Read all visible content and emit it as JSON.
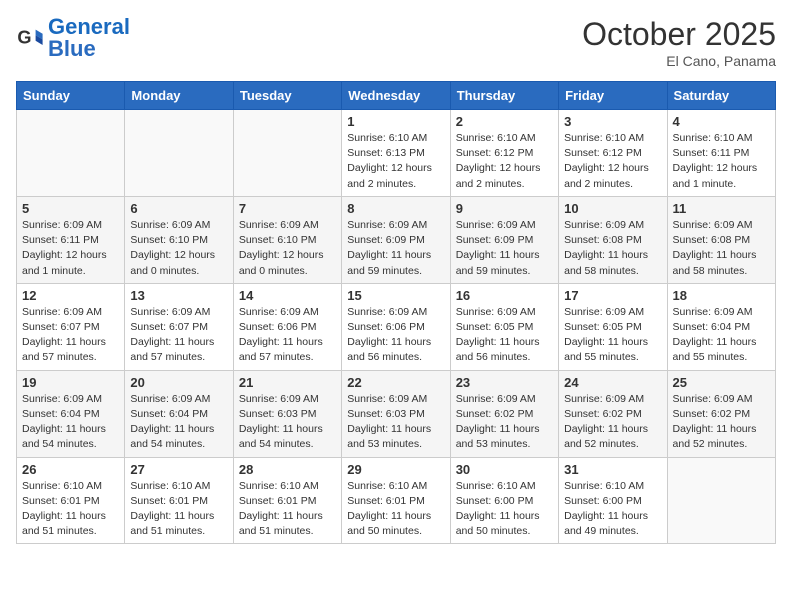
{
  "logo": {
    "text1": "General",
    "text2": "Blue"
  },
  "title": "October 2025",
  "location": "El Cano, Panama",
  "weekdays": [
    "Sunday",
    "Monday",
    "Tuesday",
    "Wednesday",
    "Thursday",
    "Friday",
    "Saturday"
  ],
  "weeks": [
    [
      {
        "day": "",
        "info": ""
      },
      {
        "day": "",
        "info": ""
      },
      {
        "day": "",
        "info": ""
      },
      {
        "day": "1",
        "info": "Sunrise: 6:10 AM\nSunset: 6:13 PM\nDaylight: 12 hours and 2 minutes."
      },
      {
        "day": "2",
        "info": "Sunrise: 6:10 AM\nSunset: 6:12 PM\nDaylight: 12 hours and 2 minutes."
      },
      {
        "day": "3",
        "info": "Sunrise: 6:10 AM\nSunset: 6:12 PM\nDaylight: 12 hours and 2 minutes."
      },
      {
        "day": "4",
        "info": "Sunrise: 6:10 AM\nSunset: 6:11 PM\nDaylight: 12 hours and 1 minute."
      }
    ],
    [
      {
        "day": "5",
        "info": "Sunrise: 6:09 AM\nSunset: 6:11 PM\nDaylight: 12 hours and 1 minute."
      },
      {
        "day": "6",
        "info": "Sunrise: 6:09 AM\nSunset: 6:10 PM\nDaylight: 12 hours and 0 minutes."
      },
      {
        "day": "7",
        "info": "Sunrise: 6:09 AM\nSunset: 6:10 PM\nDaylight: 12 hours and 0 minutes."
      },
      {
        "day": "8",
        "info": "Sunrise: 6:09 AM\nSunset: 6:09 PM\nDaylight: 11 hours and 59 minutes."
      },
      {
        "day": "9",
        "info": "Sunrise: 6:09 AM\nSunset: 6:09 PM\nDaylight: 11 hours and 59 minutes."
      },
      {
        "day": "10",
        "info": "Sunrise: 6:09 AM\nSunset: 6:08 PM\nDaylight: 11 hours and 58 minutes."
      },
      {
        "day": "11",
        "info": "Sunrise: 6:09 AM\nSunset: 6:08 PM\nDaylight: 11 hours and 58 minutes."
      }
    ],
    [
      {
        "day": "12",
        "info": "Sunrise: 6:09 AM\nSunset: 6:07 PM\nDaylight: 11 hours and 57 minutes."
      },
      {
        "day": "13",
        "info": "Sunrise: 6:09 AM\nSunset: 6:07 PM\nDaylight: 11 hours and 57 minutes."
      },
      {
        "day": "14",
        "info": "Sunrise: 6:09 AM\nSunset: 6:06 PM\nDaylight: 11 hours and 57 minutes."
      },
      {
        "day": "15",
        "info": "Sunrise: 6:09 AM\nSunset: 6:06 PM\nDaylight: 11 hours and 56 minutes."
      },
      {
        "day": "16",
        "info": "Sunrise: 6:09 AM\nSunset: 6:05 PM\nDaylight: 11 hours and 56 minutes."
      },
      {
        "day": "17",
        "info": "Sunrise: 6:09 AM\nSunset: 6:05 PM\nDaylight: 11 hours and 55 minutes."
      },
      {
        "day": "18",
        "info": "Sunrise: 6:09 AM\nSunset: 6:04 PM\nDaylight: 11 hours and 55 minutes."
      }
    ],
    [
      {
        "day": "19",
        "info": "Sunrise: 6:09 AM\nSunset: 6:04 PM\nDaylight: 11 hours and 54 minutes."
      },
      {
        "day": "20",
        "info": "Sunrise: 6:09 AM\nSunset: 6:04 PM\nDaylight: 11 hours and 54 minutes."
      },
      {
        "day": "21",
        "info": "Sunrise: 6:09 AM\nSunset: 6:03 PM\nDaylight: 11 hours and 54 minutes."
      },
      {
        "day": "22",
        "info": "Sunrise: 6:09 AM\nSunset: 6:03 PM\nDaylight: 11 hours and 53 minutes."
      },
      {
        "day": "23",
        "info": "Sunrise: 6:09 AM\nSunset: 6:02 PM\nDaylight: 11 hours and 53 minutes."
      },
      {
        "day": "24",
        "info": "Sunrise: 6:09 AM\nSunset: 6:02 PM\nDaylight: 11 hours and 52 minutes."
      },
      {
        "day": "25",
        "info": "Sunrise: 6:09 AM\nSunset: 6:02 PM\nDaylight: 11 hours and 52 minutes."
      }
    ],
    [
      {
        "day": "26",
        "info": "Sunrise: 6:10 AM\nSunset: 6:01 PM\nDaylight: 11 hours and 51 minutes."
      },
      {
        "day": "27",
        "info": "Sunrise: 6:10 AM\nSunset: 6:01 PM\nDaylight: 11 hours and 51 minutes."
      },
      {
        "day": "28",
        "info": "Sunrise: 6:10 AM\nSunset: 6:01 PM\nDaylight: 11 hours and 51 minutes."
      },
      {
        "day": "29",
        "info": "Sunrise: 6:10 AM\nSunset: 6:01 PM\nDaylight: 11 hours and 50 minutes."
      },
      {
        "day": "30",
        "info": "Sunrise: 6:10 AM\nSunset: 6:00 PM\nDaylight: 11 hours and 50 minutes."
      },
      {
        "day": "31",
        "info": "Sunrise: 6:10 AM\nSunset: 6:00 PM\nDaylight: 11 hours and 49 minutes."
      },
      {
        "day": "",
        "info": ""
      }
    ]
  ]
}
